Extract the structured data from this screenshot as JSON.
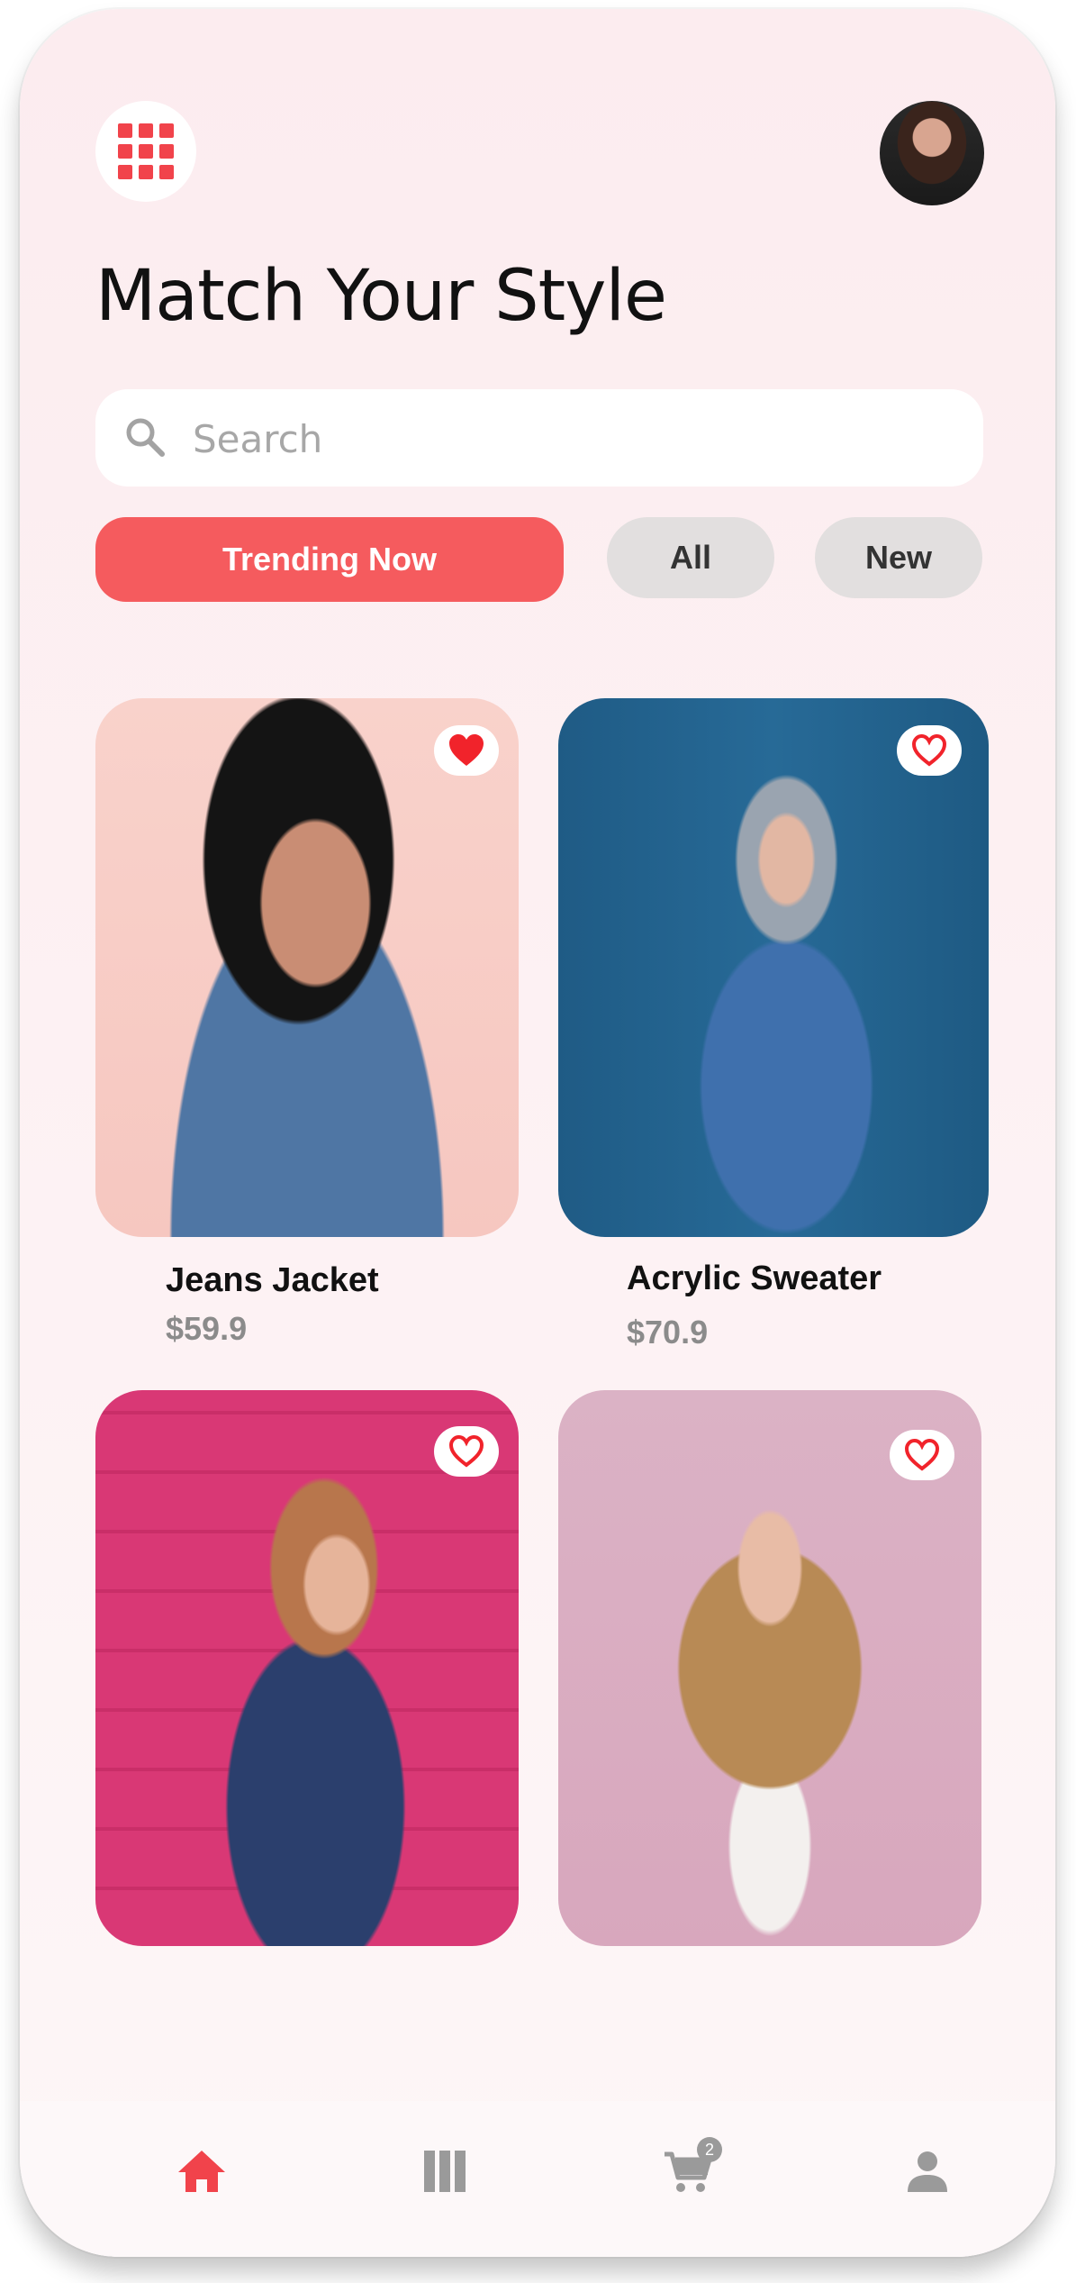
{
  "header": {
    "title": "Match Your Style",
    "menu_icon": "grid-menu-icon",
    "avatar_icon": "user-avatar"
  },
  "search": {
    "placeholder": "Search",
    "value": ""
  },
  "filters": {
    "items": [
      {
        "label": "Trending Now",
        "active": true
      },
      {
        "label": "All",
        "active": false
      },
      {
        "label": "New",
        "active": false
      }
    ]
  },
  "products": [
    {
      "name": "Jeans Jacket",
      "price": "$59.9",
      "favorited": true
    },
    {
      "name": "Acrylic Sweater",
      "price": "$70.9",
      "favorited": false
    },
    {
      "favorited": false
    },
    {
      "favorited": false
    }
  ],
  "bottom_nav": {
    "items": [
      {
        "icon": "home-icon",
        "active": true
      },
      {
        "icon": "catalog-icon",
        "active": false
      },
      {
        "icon": "cart-icon",
        "active": false,
        "badge": "2"
      },
      {
        "icon": "profile-icon",
        "active": false
      }
    ]
  },
  "colors": {
    "accent": "#f55b5e",
    "icon_red": "#f1434b",
    "inactive_icon": "#9a9a9a",
    "chip_inactive": "#e2dfdf",
    "background": "#fcecef"
  }
}
